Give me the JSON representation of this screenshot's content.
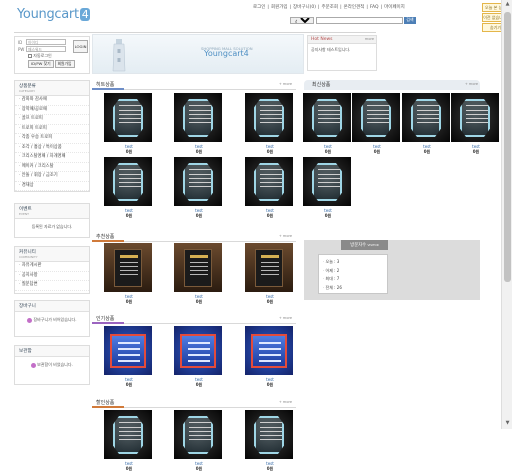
{
  "header": {
    "logo_text": "Youngcart",
    "logo_num": "4",
    "topnav": [
      "로그인",
      "회원가입",
      "장바구니(0)",
      "주문조회",
      "온라인견적",
      "FAQ",
      "마이페이지"
    ],
    "search_select": "상품",
    "search_placeholder": "",
    "search_button": "검색"
  },
  "today_box": {
    "title": "오늘 본 상품",
    "empty": "이전 없습니다.",
    "next": "숨기기"
  },
  "login": {
    "id_label": "ID",
    "pw_label": "PW",
    "id_placeholder": "아이디",
    "pw_placeholder": "패스워드",
    "login_button": "LOGIN",
    "auto_login": "자동로그인",
    "find_button": "ID/PW 찾기",
    "join_button": "회원가입"
  },
  "banner": {
    "small": "SHOPPING MALL SOLUTION",
    "big": "Youngcart4"
  },
  "hotnews": {
    "title": "Hot News",
    "more": "more",
    "item": "공지사항 테스트입니다."
  },
  "sidebar": {
    "category_title": "상품분류",
    "category_sub": "CATEGORY",
    "categories": [
      "감화와 감사패",
      "장학패/공로패",
      "골프 트로피",
      "트로피 트로피",
      "각종 우승 트로피",
      "조각 / 흉상 / 특이상품",
      "크리스탈명패 / 자개명패",
      "메이커 / 크리스탈",
      "안돌 / 휘장 / 금조기",
      "경재상"
    ],
    "event_title": "이벤트",
    "event_sub": "EVENT",
    "event_msg": "등록된 자료가 없습니다.",
    "community_title": "커뮤니티",
    "community_sub": "COMMUNITY",
    "community_items": [
      "자유게시판",
      "공지사항",
      "질문답변"
    ],
    "cart_title": "장바구니",
    "cart_msg": "장바구니가 비어있습니다.",
    "wish_title": "보관함",
    "wish_msg": "보관함이 비었습니다."
  },
  "sections": {
    "hit": {
      "title": "히트상품",
      "more": "+ more",
      "color": "#6d8dc7"
    },
    "rec": {
      "title": "추천상품",
      "more": "+ more",
      "color": "#d07a3a"
    },
    "pop": {
      "title": "인기상품",
      "more": "+ more",
      "color": "#9b64c0"
    },
    "sale": {
      "title": "할인상품",
      "more": "+ more",
      "color": "#d17a3a"
    }
  },
  "product": {
    "name": "test",
    "price": "0원"
  },
  "newbox": {
    "title": "최신상품",
    "more": "+ more"
  },
  "visitor": {
    "title": "방문자수",
    "sub": "VISITOR",
    "rows": [
      "오늘 : 3",
      "어제 : 2",
      "최대 : 7",
      "전체 : 26"
    ]
  }
}
